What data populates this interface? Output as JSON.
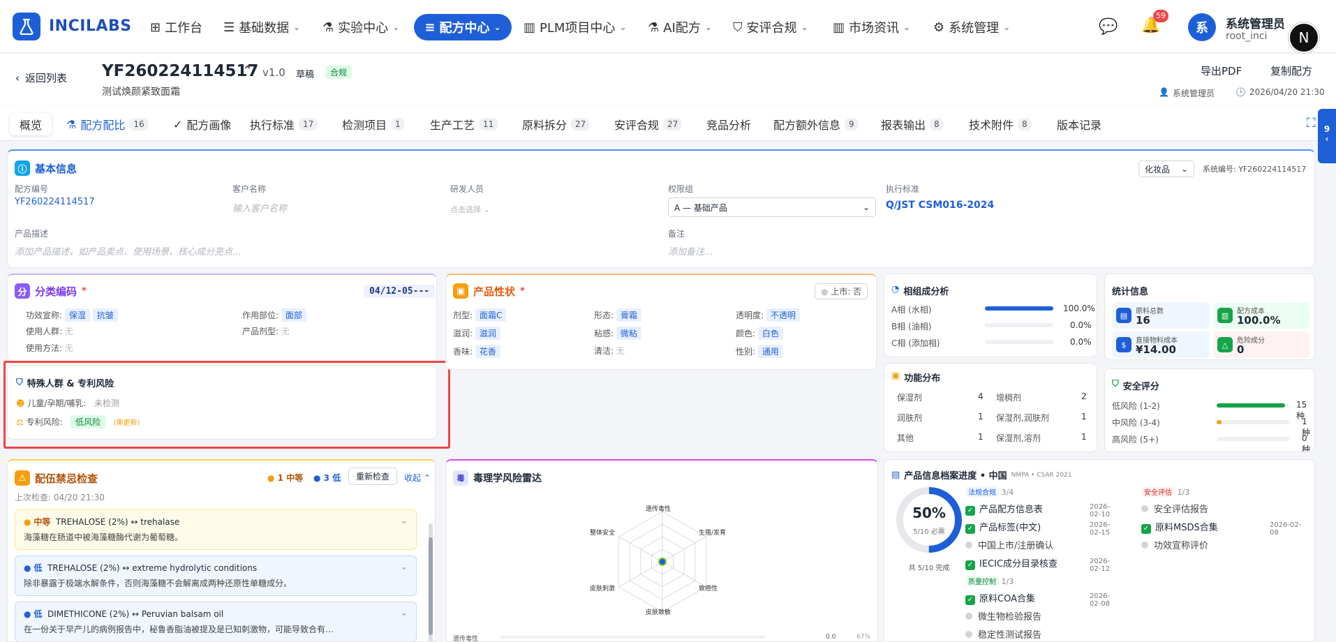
{
  "nav": {
    "brand": "INCILABS",
    "items": [
      {
        "label": "工作台",
        "chev": ""
      },
      {
        "label": "基础数据",
        "chev": "⌄"
      },
      {
        "label": "实验中心",
        "chev": "⌄"
      },
      {
        "label": "配方中心",
        "chev": "⌄"
      },
      {
        "label": "PLM项目中心",
        "chev": "⌄"
      },
      {
        "label": "AI配方",
        "chev": "⌄"
      },
      {
        "label": "安评合规",
        "chev": "⌄"
      },
      {
        "label": "市场资讯",
        "chev": "⌄"
      },
      {
        "label": "系统管理",
        "chev": "⌄"
      }
    ],
    "notifications": "59",
    "avatar": "系",
    "user_name": "系统管理员",
    "user_id": "root_inci",
    "corner_badge": "N",
    "accent": "#1e5fd8"
  },
  "header": {
    "back": "返回列表",
    "code": "YF260224114517",
    "version": "v1.0",
    "status": "草稿",
    "compliance": "合规",
    "subtitle": "测试焕颜紧致面霜",
    "export_pdf": "导出PDF",
    "copy": "复制配方",
    "owner": "系统管理员",
    "date": "2026/04/20 21:30"
  },
  "tabs": [
    {
      "label": "概览",
      "count": ""
    },
    {
      "label": "配方配比",
      "count": "16"
    },
    {
      "label": "配方画像",
      "count": ""
    },
    {
      "label": "执行标准",
      "count": "17"
    },
    {
      "label": "检测项目",
      "count": "1"
    },
    {
      "label": "生产工艺",
      "count": "11"
    },
    {
      "label": "原料拆分",
      "count": "27"
    },
    {
      "label": "安评合规",
      "count": "27"
    },
    {
      "label": "竞品分析",
      "count": ""
    },
    {
      "label": "配方额外信息",
      "count": "9"
    },
    {
      "label": "报表输出",
      "count": "8"
    },
    {
      "label": "技术附件",
      "count": "8"
    },
    {
      "label": "版本记录",
      "count": ""
    }
  ],
  "side_tab": "9",
  "basic": {
    "title": "基本信息",
    "category": "化妆品",
    "sys_no": "系统编号: YF260224114517",
    "code_label": "配方编号",
    "code": "YF260224114517",
    "client_label": "客户名称",
    "client_ph": "输入客户名称",
    "rd_label": "研发人员",
    "rd_ph": "点击选择",
    "perm_label": "权限组",
    "perm_value": "A — 基础产品",
    "std_label": "执行标准",
    "std_value": "Q/JST CSM016-2024",
    "desc_label": "产品描述",
    "desc_ph": "添加产品描述，如产品卖点、使用场景、核心成分亮点...",
    "note_label": "备注",
    "note_ph": "添加备注..."
  },
  "classify": {
    "title": "分类编码",
    "star": "*",
    "code": "04/12-05---",
    "efficacy_label": "功效宣称:",
    "efficacy": [
      "保湿",
      "抗皱"
    ],
    "part_label": "作用部位:",
    "part": "面部",
    "people_label": "使用人群:",
    "people": "无",
    "form_label": "产品剂型:",
    "form": "无",
    "method_label": "使用方法:",
    "method": "无"
  },
  "special": {
    "title": "特殊人群 & 专利风险",
    "child_label": "儿童/孕期/哺乳:",
    "child_value": "未检测",
    "patent_label": "专利风险:",
    "patent_value": "低风险",
    "patent_note": "(需更新)"
  },
  "props": {
    "title": "产品性状",
    "star": "*",
    "market": "上市: 否",
    "items": [
      {
        "label": "剂型:",
        "value": "面霜C"
      },
      {
        "label": "形态:",
        "value": "膏霜"
      },
      {
        "label": "透明度:",
        "value": "不透明"
      },
      {
        "label": "滋润:",
        "value": "滋润"
      },
      {
        "label": "粘感:",
        "value": "微粘"
      },
      {
        "label": "颜色:",
        "value": "白色"
      },
      {
        "label": "香味:",
        "value": "花香"
      },
      {
        "label": "清洁:",
        "value": "无"
      },
      {
        "label": "性别:",
        "value": "通用"
      }
    ]
  },
  "phase": {
    "title": "相组成分析",
    "rows": [
      {
        "label": "A相 (水相)",
        "pct": "100.0%",
        "value": 100
      },
      {
        "label": "B相 (油相)",
        "pct": "0.0%",
        "value": 0
      },
      {
        "label": "C相 (添加相)",
        "pct": "0.0%",
        "value": 0
      }
    ]
  },
  "stats": {
    "title": "统计信息",
    "items": [
      {
        "label": "原料总数",
        "value": "16"
      },
      {
        "label": "配方成本",
        "value": "100.0%"
      },
      {
        "label": "直接物料成本",
        "value": "¥14.00"
      },
      {
        "label": "危险成分",
        "value": "0"
      }
    ]
  },
  "function": {
    "title": "功能分布",
    "items": [
      {
        "name": "保湿剂",
        "count": "4"
      },
      {
        "name": "增稠剂",
        "count": "2"
      },
      {
        "name": "润肤剂",
        "count": "1"
      },
      {
        "name": "保湿剂,润肤剂",
        "count": "1"
      },
      {
        "name": "其他",
        "count": "1"
      },
      {
        "name": "保湿剂,溶剂",
        "count": "1"
      }
    ]
  },
  "safety": {
    "title": "安全评分",
    "rows": [
      {
        "label": "低风险 (1-2)",
        "count": "15种",
        "value": 15
      },
      {
        "label": "中风险 (3-4)",
        "count": "1种",
        "value": 1
      },
      {
        "label": "高风险 (5+)",
        "count": "0种",
        "value": 0
      }
    ]
  },
  "compat": {
    "title": "配伍禁忌检查",
    "medium": "1 中等",
    "low": "3 低",
    "recheck": "重新检查",
    "collapse": "收起",
    "last": "上次检查: 04/20 21:30",
    "items": [
      {
        "level": "中等",
        "title": "TREHALOSE (2%) ↔ trehalase",
        "desc": "海藻糖在肠道中被海藻糖酶代谢为葡萄糖。"
      },
      {
        "level": "低",
        "title": "TREHALOSE (2%) ↔ extreme hydrolytic conditions",
        "desc": "除非暴露于极端水解条件，否则海藻糖不会解离成两种还原性单糖成分。"
      },
      {
        "level": "低",
        "title": "DIMETHICONE (2%) ↔ Peruvian balsam oil",
        "desc": "在一份关于早产儿的病例报告中，秘鲁香脂油被提及是已知刺激物，可能导致合有…"
      }
    ]
  },
  "radar": {
    "title": "毒理学风险雷达",
    "icon": "毒",
    "axes": [
      "遗传毒性",
      "生殖/发育",
      "致癌性",
      "皮肤致敏",
      "皮肤刺激",
      "整体安全"
    ],
    "bottom_label": "遗传毒性",
    "bottom_value": "0.0",
    "bottom_pct": "67%"
  },
  "archive": {
    "title": "产品信息档案进度 • 中国",
    "sub": "NMPA • CSAR 2021",
    "percent": "50%",
    "percent_value": 50,
    "required": "5/10 必需",
    "total": "共 5/10 完成",
    "groups": [
      {
        "title": "法规合规",
        "count": "3/4",
        "items": [
          {
            "name": "产品配方信息表",
            "date": "2026-02-10",
            "done": true
          },
          {
            "name": "产品标签(中文)",
            "date": "2026-02-15",
            "done": true
          },
          {
            "name": "中国上市/注册确认",
            "date": "",
            "done": false
          },
          {
            "name": "IECIC成分目录核查",
            "date": "2026-02-12",
            "done": true
          }
        ]
      },
      {
        "title": "安全评估",
        "count": "1/3",
        "items": [
          {
            "name": "安全评估报告",
            "date": "",
            "done": false
          },
          {
            "name": "原料MSDS合集",
            "date": "2026-02-08",
            "done": true
          },
          {
            "name": "功效宣称评价",
            "date": "",
            "done": false
          }
        ]
      },
      {
        "title": "质量控制",
        "count": "1/3",
        "items": [
          {
            "name": "原料COA合集",
            "date": "2026-02-08",
            "done": true
          },
          {
            "name": "微生物检验报告",
            "date": "",
            "done": false
          },
          {
            "name": "稳定性测试报告",
            "date": "",
            "done": false
          }
        ]
      }
    ]
  }
}
